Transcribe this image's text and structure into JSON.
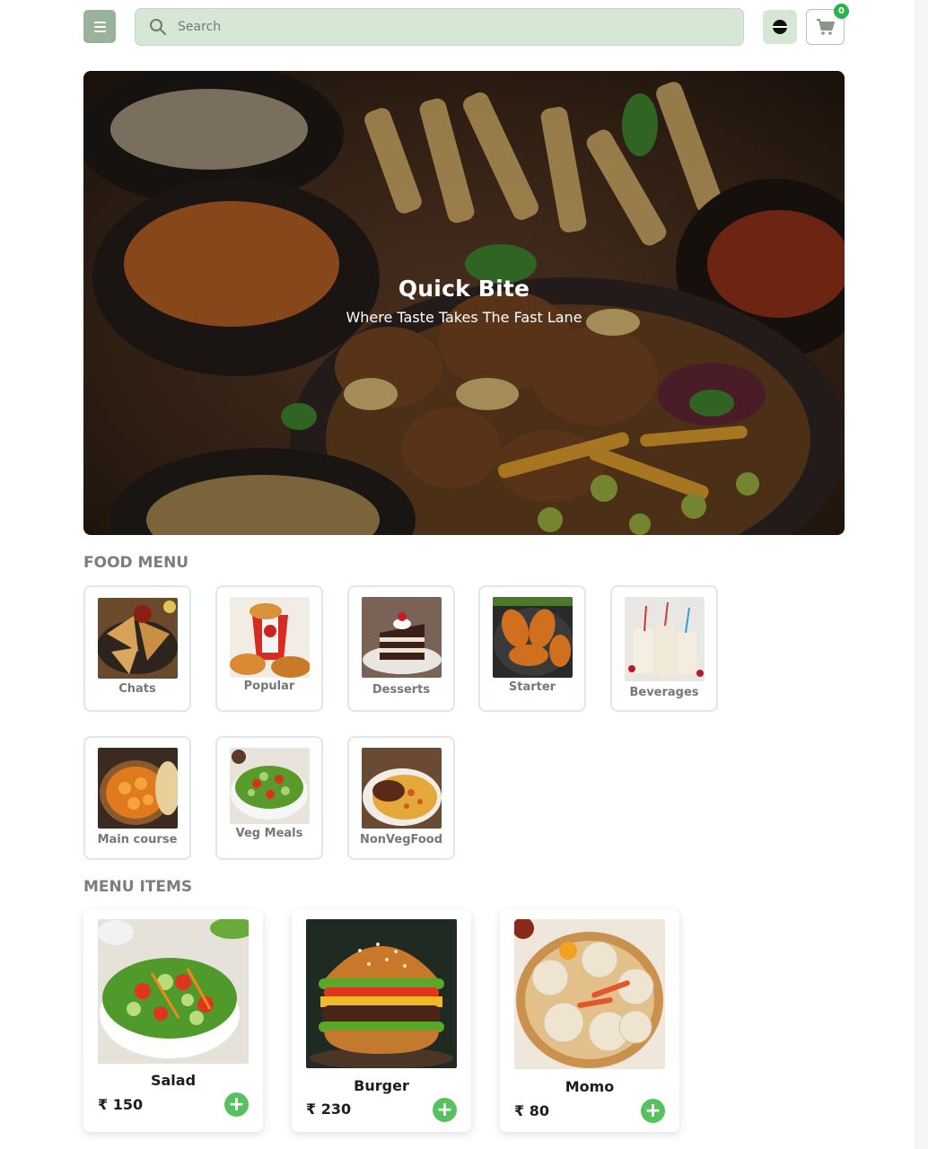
{
  "header": {
    "search_placeholder": "Search",
    "cart_count": "0"
  },
  "hero": {
    "title": "Quick Bite",
    "subtitle": "Where Taste Takes The Fast Lane"
  },
  "food_menu": {
    "title": "FOOD MENU",
    "categories": [
      {
        "label": "Chats"
      },
      {
        "label": "Popular"
      },
      {
        "label": "Desserts"
      },
      {
        "label": "Starter"
      },
      {
        "label": "Beverages"
      },
      {
        "label": "Main course"
      },
      {
        "label": "Veg Meals"
      },
      {
        "label": "NonVegFood"
      }
    ]
  },
  "menu_items": {
    "title": "MENU ITEMS",
    "items": [
      {
        "name": "Salad",
        "price": "₹ 150"
      },
      {
        "name": "Burger",
        "price": "₹ 230"
      },
      {
        "name": "Momo",
        "price": "₹ 80"
      }
    ]
  },
  "colors": {
    "accent": "#98b39a",
    "search_bg": "#d6e7d6",
    "add_button": "#57c15f",
    "badge": "#29b34a"
  }
}
